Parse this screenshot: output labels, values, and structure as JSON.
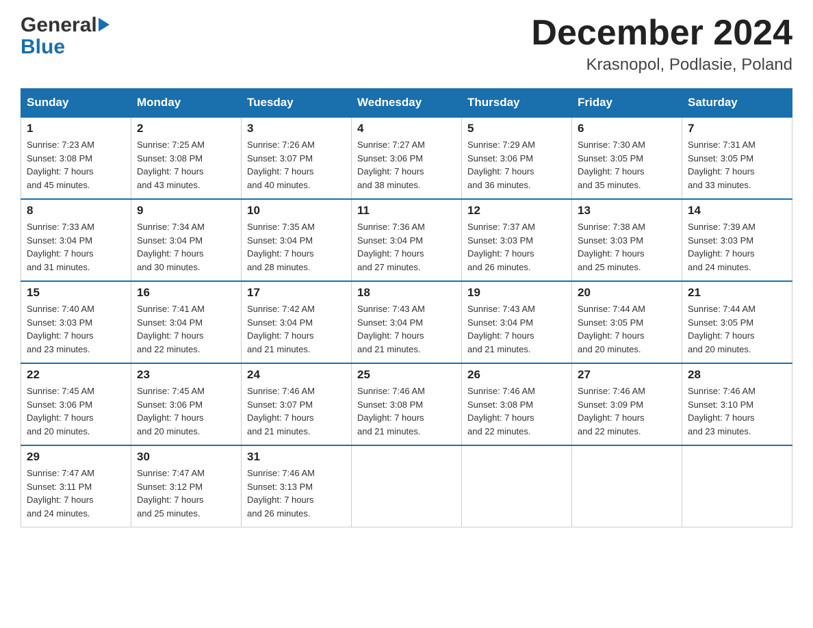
{
  "header": {
    "logo_general": "General",
    "logo_blue": "Blue",
    "title": "December 2024",
    "subtitle": "Krasnopol, Podlasie, Poland"
  },
  "calendar": {
    "days_of_week": [
      "Sunday",
      "Monday",
      "Tuesday",
      "Wednesday",
      "Thursday",
      "Friday",
      "Saturday"
    ],
    "weeks": [
      [
        {
          "day": "1",
          "sunrise": "7:23 AM",
          "sunset": "3:08 PM",
          "daylight": "7 hours and 45 minutes."
        },
        {
          "day": "2",
          "sunrise": "7:25 AM",
          "sunset": "3:08 PM",
          "daylight": "7 hours and 43 minutes."
        },
        {
          "day": "3",
          "sunrise": "7:26 AM",
          "sunset": "3:07 PM",
          "daylight": "7 hours and 40 minutes."
        },
        {
          "day": "4",
          "sunrise": "7:27 AM",
          "sunset": "3:06 PM",
          "daylight": "7 hours and 38 minutes."
        },
        {
          "day": "5",
          "sunrise": "7:29 AM",
          "sunset": "3:06 PM",
          "daylight": "7 hours and 36 minutes."
        },
        {
          "day": "6",
          "sunrise": "7:30 AM",
          "sunset": "3:05 PM",
          "daylight": "7 hours and 35 minutes."
        },
        {
          "day": "7",
          "sunrise": "7:31 AM",
          "sunset": "3:05 PM",
          "daylight": "7 hours and 33 minutes."
        }
      ],
      [
        {
          "day": "8",
          "sunrise": "7:33 AM",
          "sunset": "3:04 PM",
          "daylight": "7 hours and 31 minutes."
        },
        {
          "day": "9",
          "sunrise": "7:34 AM",
          "sunset": "3:04 PM",
          "daylight": "7 hours and 30 minutes."
        },
        {
          "day": "10",
          "sunrise": "7:35 AM",
          "sunset": "3:04 PM",
          "daylight": "7 hours and 28 minutes."
        },
        {
          "day": "11",
          "sunrise": "7:36 AM",
          "sunset": "3:04 PM",
          "daylight": "7 hours and 27 minutes."
        },
        {
          "day": "12",
          "sunrise": "7:37 AM",
          "sunset": "3:03 PM",
          "daylight": "7 hours and 26 minutes."
        },
        {
          "day": "13",
          "sunrise": "7:38 AM",
          "sunset": "3:03 PM",
          "daylight": "7 hours and 25 minutes."
        },
        {
          "day": "14",
          "sunrise": "7:39 AM",
          "sunset": "3:03 PM",
          "daylight": "7 hours and 24 minutes."
        }
      ],
      [
        {
          "day": "15",
          "sunrise": "7:40 AM",
          "sunset": "3:03 PM",
          "daylight": "7 hours and 23 minutes."
        },
        {
          "day": "16",
          "sunrise": "7:41 AM",
          "sunset": "3:04 PM",
          "daylight": "7 hours and 22 minutes."
        },
        {
          "day": "17",
          "sunrise": "7:42 AM",
          "sunset": "3:04 PM",
          "daylight": "7 hours and 21 minutes."
        },
        {
          "day": "18",
          "sunrise": "7:43 AM",
          "sunset": "3:04 PM",
          "daylight": "7 hours and 21 minutes."
        },
        {
          "day": "19",
          "sunrise": "7:43 AM",
          "sunset": "3:04 PM",
          "daylight": "7 hours and 21 minutes."
        },
        {
          "day": "20",
          "sunrise": "7:44 AM",
          "sunset": "3:05 PM",
          "daylight": "7 hours and 20 minutes."
        },
        {
          "day": "21",
          "sunrise": "7:44 AM",
          "sunset": "3:05 PM",
          "daylight": "7 hours and 20 minutes."
        }
      ],
      [
        {
          "day": "22",
          "sunrise": "7:45 AM",
          "sunset": "3:06 PM",
          "daylight": "7 hours and 20 minutes."
        },
        {
          "day": "23",
          "sunrise": "7:45 AM",
          "sunset": "3:06 PM",
          "daylight": "7 hours and 20 minutes."
        },
        {
          "day": "24",
          "sunrise": "7:46 AM",
          "sunset": "3:07 PM",
          "daylight": "7 hours and 21 minutes."
        },
        {
          "day": "25",
          "sunrise": "7:46 AM",
          "sunset": "3:08 PM",
          "daylight": "7 hours and 21 minutes."
        },
        {
          "day": "26",
          "sunrise": "7:46 AM",
          "sunset": "3:08 PM",
          "daylight": "7 hours and 22 minutes."
        },
        {
          "day": "27",
          "sunrise": "7:46 AM",
          "sunset": "3:09 PM",
          "daylight": "7 hours and 22 minutes."
        },
        {
          "day": "28",
          "sunrise": "7:46 AM",
          "sunset": "3:10 PM",
          "daylight": "7 hours and 23 minutes."
        }
      ],
      [
        {
          "day": "29",
          "sunrise": "7:47 AM",
          "sunset": "3:11 PM",
          "daylight": "7 hours and 24 minutes."
        },
        {
          "day": "30",
          "sunrise": "7:47 AM",
          "sunset": "3:12 PM",
          "daylight": "7 hours and 25 minutes."
        },
        {
          "day": "31",
          "sunrise": "7:46 AM",
          "sunset": "3:13 PM",
          "daylight": "7 hours and 26 minutes."
        },
        null,
        null,
        null,
        null
      ]
    ]
  }
}
